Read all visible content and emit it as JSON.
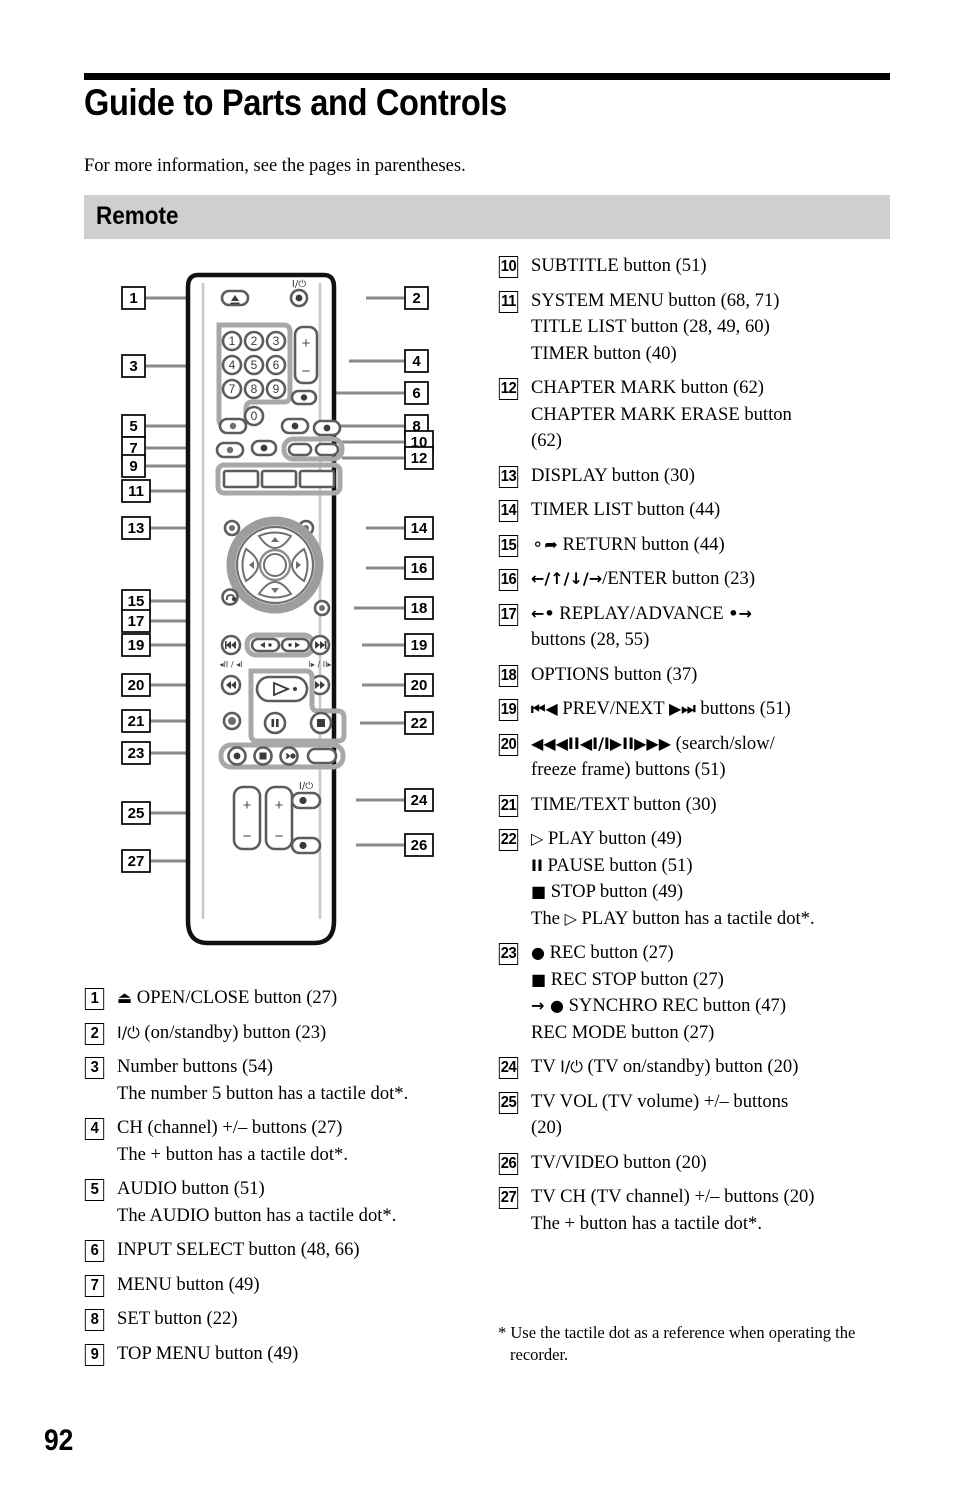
{
  "page": {
    "title": "Guide to Parts and Controls",
    "intro": "For more information, see the pages in parentheses.",
    "section_heading": "Remote",
    "page_number": "92",
    "footnote": "* Use the tactile dot as a reference when operating the recorder."
  },
  "figure": {
    "caption": "Remote control diagram with numbered callouts 1 through 27",
    "callouts_left": [
      "1",
      "3",
      "5",
      "7",
      "9",
      "11",
      "13",
      "15",
      "17",
      "19",
      "20",
      "21",
      "23",
      "25",
      "27"
    ],
    "callouts_right": [
      "2",
      "4",
      "6",
      "8",
      "10",
      "12",
      "14",
      "16",
      "18",
      "19",
      "20",
      "22",
      "24",
      "26"
    ],
    "keypad_digits": [
      "1",
      "2",
      "3",
      "4",
      "5",
      "6",
      "7",
      "8",
      "9",
      "0"
    ],
    "rocker_plus": "+",
    "rocker_minus": "−",
    "power_mark": "I/⏻",
    "slow_label_left": "◀II / ◀I",
    "slow_label_right": "I▶ / II▶"
  },
  "items_left": [
    {
      "num": "1",
      "lines": [
        [
          {
            "t": "glyph",
            "v": "⏏"
          },
          {
            "t": "text",
            "v": " OPEN/CLOSE button (27)"
          }
        ]
      ]
    },
    {
      "num": "2",
      "lines": [
        [
          {
            "t": "glyph",
            "v": "I/⏻"
          },
          {
            "t": "text",
            "v": " (on/standby) button (23)"
          }
        ]
      ]
    },
    {
      "num": "3",
      "lines": [
        [
          {
            "t": "text",
            "v": "Number buttons (54)"
          }
        ],
        [
          {
            "t": "text",
            "v": "The number 5 button has a tactile dot*."
          }
        ]
      ]
    },
    {
      "num": "4",
      "lines": [
        [
          {
            "t": "text",
            "v": "CH (channel) +/– buttons (27)"
          }
        ],
        [
          {
            "t": "text",
            "v": "The + button has a tactile dot*."
          }
        ]
      ]
    },
    {
      "num": "5",
      "lines": [
        [
          {
            "t": "text",
            "v": "AUDIO button (51)"
          }
        ],
        [
          {
            "t": "text",
            "v": "The AUDIO button has a tactile dot*."
          }
        ]
      ]
    },
    {
      "num": "6",
      "lines": [
        [
          {
            "t": "text",
            "v": "INPUT SELECT button (48, 66)"
          }
        ]
      ]
    },
    {
      "num": "7",
      "lines": [
        [
          {
            "t": "text",
            "v": "MENU button (49)"
          }
        ]
      ]
    },
    {
      "num": "8",
      "lines": [
        [
          {
            "t": "text",
            "v": "SET button (22)"
          }
        ]
      ]
    },
    {
      "num": "9",
      "lines": [
        [
          {
            "t": "text",
            "v": "TOP MENU button (49)"
          }
        ]
      ]
    }
  ],
  "items_right": [
    {
      "num": "10",
      "lines": [
        [
          {
            "t": "text",
            "v": "SUBTITLE button (51)"
          }
        ]
      ]
    },
    {
      "num": "11",
      "lines": [
        [
          {
            "t": "text",
            "v": "SYSTEM MENU button (68, 71)"
          }
        ],
        [
          {
            "t": "text",
            "v": "TITLE LIST button (28, 49, 60)"
          }
        ],
        [
          {
            "t": "text",
            "v": "TIMER button (40)"
          }
        ]
      ]
    },
    {
      "num": "12",
      "lines": [
        [
          {
            "t": "text",
            "v": "CHAPTER MARK button (62)"
          }
        ],
        [
          {
            "t": "text",
            "v": "CHAPTER MARK ERASE button"
          }
        ],
        [
          {
            "t": "text",
            "v": "(62)"
          }
        ]
      ]
    },
    {
      "num": "13",
      "lines": [
        [
          {
            "t": "text",
            "v": "DISPLAY button (30)"
          }
        ]
      ]
    },
    {
      "num": "14",
      "lines": [
        [
          {
            "t": "text",
            "v": "TIMER LIST button (44)"
          }
        ]
      ]
    },
    {
      "num": "15",
      "lines": [
        [
          {
            "t": "glyph",
            "v": "⚬➦"
          },
          {
            "t": "text",
            "v": " RETURN button (44)"
          }
        ]
      ]
    },
    {
      "num": "16",
      "lines": [
        [
          {
            "t": "glyphb",
            "v": "←/↑/↓/→"
          },
          {
            "t": "text",
            "v": "/ENTER button (23)"
          }
        ]
      ]
    },
    {
      "num": "17",
      "lines": [
        [
          {
            "t": "glyphb",
            "v": "←•"
          },
          {
            "t": "text",
            "v": " REPLAY/ADVANCE "
          },
          {
            "t": "glyphb",
            "v": "•→"
          }
        ],
        [
          {
            "t": "text",
            "v": "buttons (28, 55)"
          }
        ]
      ]
    },
    {
      "num": "18",
      "lines": [
        [
          {
            "t": "text",
            "v": "OPTIONS button (37)"
          }
        ]
      ]
    },
    {
      "num": "19",
      "lines": [
        [
          {
            "t": "glyphb",
            "v": "⏮◀"
          },
          {
            "t": "text",
            "v": " PREV/NEXT "
          },
          {
            "t": "glyphb",
            "v": "▶⏭"
          },
          {
            "t": "text",
            "v": " buttons (51)"
          }
        ]
      ]
    },
    {
      "num": "20",
      "lines": [
        [
          {
            "t": "glyphb",
            "v": "◀◀◀II◀I/I▶II▶▶▶"
          },
          {
            "t": "text",
            "v": " (search/slow/"
          }
        ],
        [
          {
            "t": "text",
            "v": "freeze frame) buttons (51)"
          }
        ]
      ]
    },
    {
      "num": "21",
      "lines": [
        [
          {
            "t": "text",
            "v": "TIME/TEXT button (30)"
          }
        ]
      ]
    },
    {
      "num": "22",
      "lines": [
        [
          {
            "t": "glyph",
            "v": "▷"
          },
          {
            "t": "text",
            "v": " PLAY button (49)"
          }
        ],
        [
          {
            "t": "glyphb",
            "v": "II"
          },
          {
            "t": "text",
            "v": " PAUSE button (51)"
          }
        ],
        [
          {
            "t": "glyphb",
            "v": "■"
          },
          {
            "t": "text",
            "v": " STOP button (49)"
          }
        ],
        [
          {
            "t": "text",
            "v": "The "
          },
          {
            "t": "glyph",
            "v": "▷"
          },
          {
            "t": "text",
            "v": " PLAY button has a tactile dot*."
          }
        ]
      ]
    },
    {
      "num": "23",
      "lines": [
        [
          {
            "t": "glyphb",
            "v": "●"
          },
          {
            "t": "text",
            "v": " REC button (27)"
          }
        ],
        [
          {
            "t": "glyphb",
            "v": "■"
          },
          {
            "t": "text",
            "v": " REC STOP button (27)"
          }
        ],
        [
          {
            "t": "glyphb",
            "v": "→ ●"
          },
          {
            "t": "text",
            "v": " SYNCHRO REC button (47)"
          }
        ],
        [
          {
            "t": "text",
            "v": "REC MODE button (27)"
          }
        ]
      ]
    },
    {
      "num": "24",
      "lines": [
        [
          {
            "t": "text",
            "v": "TV "
          },
          {
            "t": "glyph",
            "v": "I/⏻"
          },
          {
            "t": "text",
            "v": " (TV on/standby) button (20)"
          }
        ]
      ]
    },
    {
      "num": "25",
      "lines": [
        [
          {
            "t": "text",
            "v": "TV VOL (TV volume) +/– buttons"
          }
        ],
        [
          {
            "t": "text",
            "v": "(20)"
          }
        ]
      ]
    },
    {
      "num": "26",
      "lines": [
        [
          {
            "t": "text",
            "v": "TV/VIDEO button (20)"
          }
        ]
      ]
    },
    {
      "num": "27",
      "lines": [
        [
          {
            "t": "text",
            "v": "TV CH (TV channel) +/– buttons (20)"
          }
        ],
        [
          {
            "t": "text",
            "v": "The + button has a tactile dot*."
          }
        ]
      ]
    }
  ]
}
